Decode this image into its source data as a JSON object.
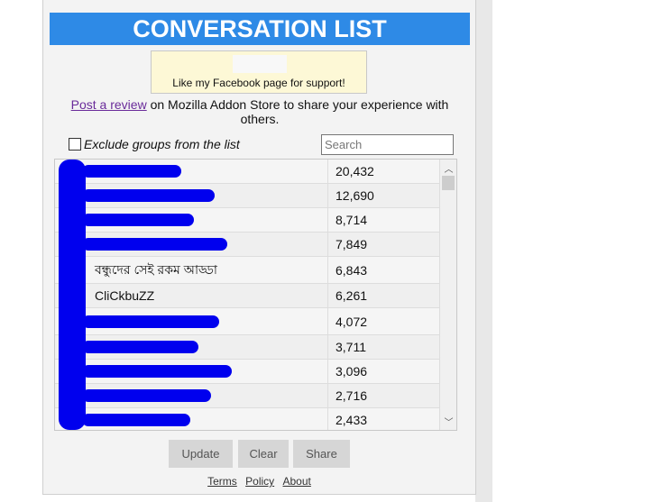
{
  "header": {
    "title": "CONVERSATION LIST"
  },
  "facebook": {
    "text": "Like my Facebook page for support!"
  },
  "review": {
    "link": "Post a review",
    "text": " on Mozilla Addon Store to share your experience with others."
  },
  "filter": {
    "exclude_label": "Exclude groups from the list",
    "exclude_checked": false,
    "search_placeholder": "Search"
  },
  "conversations": [
    {
      "name": "",
      "count": "20,432"
    },
    {
      "name": "",
      "count": "12,690"
    },
    {
      "name": "",
      "count": "8,714"
    },
    {
      "name": "",
      "count": "7,849"
    },
    {
      "name": "বন্ধুদের সেই রকম আড্ডা",
      "count": "6,843"
    },
    {
      "name": "CliCkbuZZ",
      "count": "6,261"
    },
    {
      "name": "",
      "count": "4,072"
    },
    {
      "name": "",
      "count": "3,711"
    },
    {
      "name": "",
      "count": "3,096"
    },
    {
      "name": "",
      "count": "2,716"
    },
    {
      "name": "",
      "count": "2,433"
    }
  ],
  "buttons": {
    "update": "Update",
    "clear": "Clear",
    "share": "Share"
  },
  "footer": {
    "terms": "Terms",
    "policy": "Policy",
    "about": "About"
  },
  "colors": {
    "header": "#2e8ae6",
    "redaction": "#0000ee"
  }
}
